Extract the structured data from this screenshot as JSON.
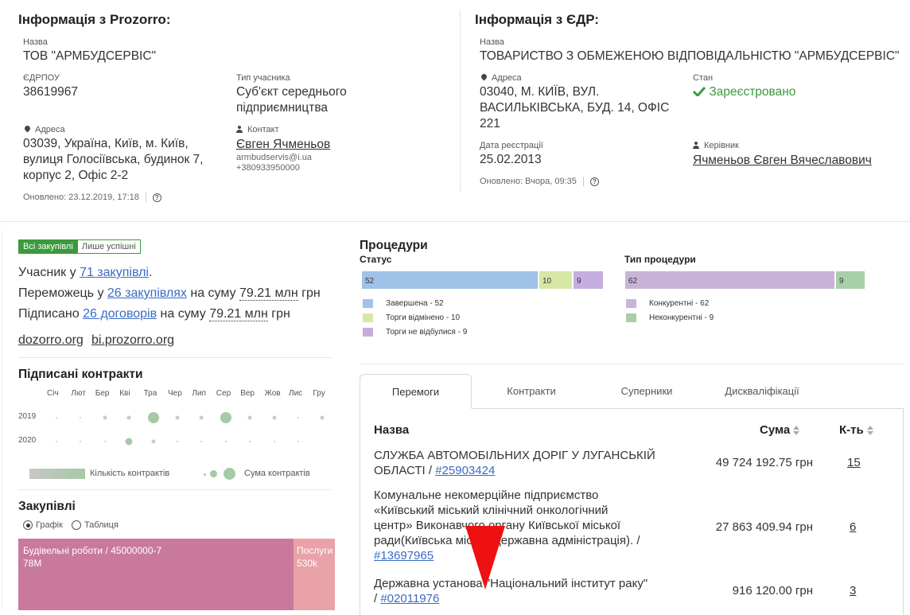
{
  "prozorro": {
    "heading": "Інформація з Prozorro:",
    "name_label": "Назва",
    "name_value": "ТОВ \"АРМБУДСЕРВІС\"",
    "edrpou_label": "ЄДРПОУ",
    "edrpou_value": "38619967",
    "type_label": "Тип учасника",
    "type_value_1": "Суб'єкт середнього",
    "type_value_2": "підприємництва",
    "address_label": "Адреса",
    "address_1": "03039, Україна, Київ, м. Київ,",
    "address_2": "вулиця Голосіївська, будинок 7,",
    "address_3": "корпус 2, Офіс 2-2",
    "contact_label": "Контакт",
    "contact_name": "Євген Ячменьов",
    "contact_email": "armbudservis@i.ua",
    "contact_phone": "+380933950000",
    "updated": "Оновлено: 23.12.2019, 17:18"
  },
  "edr": {
    "heading": "Інформація з ЄДР:",
    "name_label": "Назва",
    "name_value": "ТОВАРИСТВО З ОБМЕЖЕНОЮ ВІДПОВІДАЛЬНІСТЮ \"АРМБУДСЕРВІС\"",
    "address_label": "Адреса",
    "address_1": "03040, М. КИЇВ, ВУЛ.",
    "address_2": "ВАСИЛЬКІВСЬКА, БУД. 14, ОФІС",
    "address_3": "221",
    "state_label": "Стан",
    "state_value": "Зареєстровано",
    "reg_label": "Дата реєстрації",
    "reg_value": "25.02.2013",
    "head_label": "Керівник",
    "head_value": "Ячменьов Євген Вячеславович",
    "updated": "Оновлено: Вчора, 09:35"
  },
  "summary": {
    "toggle_all": "Всі закупівлі",
    "toggle_success": "Лише успішні",
    "line1_pre": "Учасник у ",
    "line1_link": "71 закупівлі",
    "line1_post": ".",
    "line2_pre": "Переможець у ",
    "line2_link": "26 закупівлях",
    "line2_mid": " на суму ",
    "line2_sum": "79.21 млн",
    "line2_post": " грн",
    "line3_pre": "Підписано ",
    "line3_link": "26 договорів",
    "line3_mid": " на суму ",
    "line3_sum": "79.21 млн",
    "line3_post": " грн",
    "link_dozorro": "dozorro.org",
    "link_bi": "bi.prozorro.org"
  },
  "contracts": {
    "heading": "Підписані контракти",
    "months": [
      "Січ",
      "Лют",
      "Бер",
      "Кві",
      "Тра",
      "Чер",
      "Лип",
      "Сер",
      "Вер",
      "Жов",
      "Лис",
      "Гру"
    ],
    "years": [
      "2019",
      "2020"
    ],
    "dots": [
      [
        1,
        1,
        2,
        2,
        4,
        2,
        2,
        4,
        2,
        2,
        1,
        2
      ],
      [
        1,
        1,
        1,
        3,
        2,
        1,
        1,
        1,
        1,
        1,
        1,
        0
      ]
    ],
    "legend_count": "Кількість контрактів",
    "legend_sum": "Сума контрактів"
  },
  "purchases": {
    "heading": "Закупівлі",
    "view_chart": "Графік",
    "view_table": "Таблиця",
    "view_selected": "Графік",
    "tile1_name": "Будівельні роботи / 45000000-7",
    "tile1_value": "78M",
    "tile2_name": "Послуги",
    "tile2_value": "530k"
  },
  "procedures": {
    "heading": "Процедури",
    "status_heading": "Статус",
    "type_heading": "Тип процедури",
    "status_segments": [
      {
        "label": "52",
        "value": 52,
        "color": "#9fc2e8",
        "legend": "Завершена - 52"
      },
      {
        "label": "10",
        "value": 10,
        "color": "#d7e7a6",
        "legend": "Торги відмінено - 10"
      },
      {
        "label": "9",
        "value": 9,
        "color": "#c6ade0",
        "legend": "Торги не відбулися - 9"
      }
    ],
    "type_segments": [
      {
        "label": "62",
        "value": 62,
        "color": "#c9b3d7",
        "legend": "Конкурентні - 62"
      },
      {
        "label": "9",
        "value": 9,
        "color": "#a9cfa9",
        "legend": "Неконкурентні - 9"
      }
    ]
  },
  "tabs": [
    "Перемоги",
    "Контракти",
    "Суперники",
    "Дискваліфікації"
  ],
  "active_tab": "Перемоги",
  "table": {
    "col_name": "Назва",
    "col_sum": "Сума",
    "col_count": "К-ть",
    "rows": [
      {
        "name_lines": [
          "СЛУЖБА АВТОМОБІЛЬНИХ ДОРІГ У ЛУГАНСЬКІЙ",
          "ОБЛАСТІ / "
        ],
        "id": "#25903424",
        "sum": "49 724 192.75 грн",
        "count": "15"
      },
      {
        "name_lines": [
          "Комунальне некомерційне підприємство",
          "«Київський міський клінічний онкологічний",
          "центр» Виконавчого органу Київської міської",
          "ради(Київська міська державна адміністрація). /"
        ],
        "id": "#13697965",
        "sum": "27 863 409.94 грн",
        "count": "6"
      },
      {
        "name_lines": [
          "Державна установа \"Національний інститут раку\"",
          "/ "
        ],
        "id": "#02011976",
        "sum": "916 120.00 грн",
        "count": "3"
      }
    ]
  },
  "colors": {
    "link": "#3a6bc6",
    "success": "#3c9a3c",
    "treemap_primary": "#c97a9c",
    "treemap_secondary": "#e8a2a8",
    "cursor": "#ee1111"
  }
}
